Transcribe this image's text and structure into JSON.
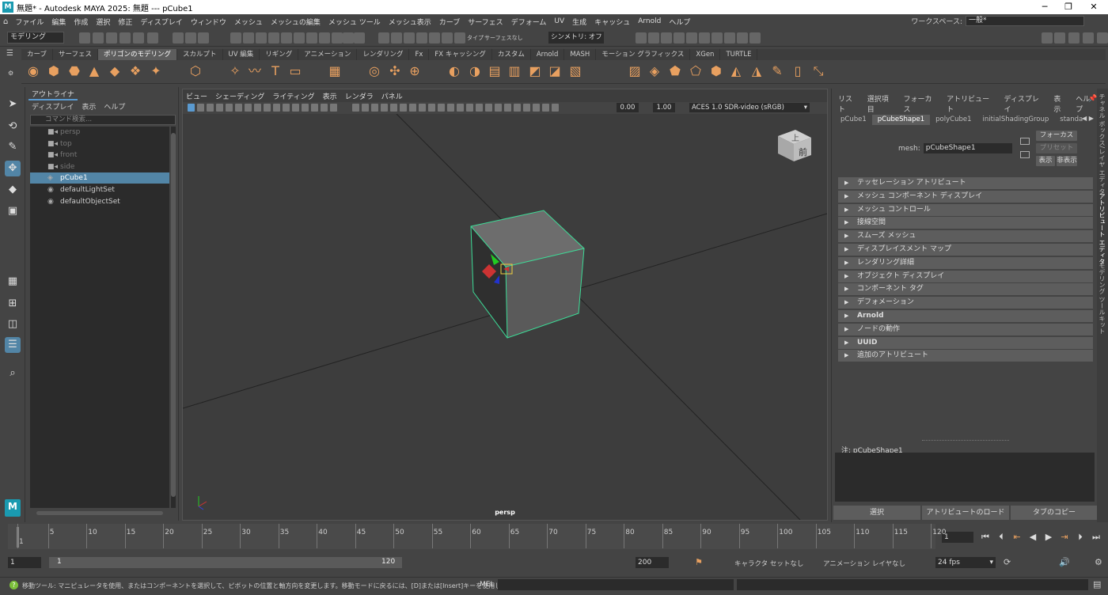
{
  "window": {
    "title": "無題* - Autodesk MAYA 2025: 無題   ---   pCube1",
    "minimize": "─",
    "maximize": "❐",
    "close": "✕"
  },
  "menu": [
    "ファイル",
    "編集",
    "作成",
    "選択",
    "修正",
    "ディスプレイ",
    "ウィンドウ",
    "メッシュ",
    "メッシュの編集",
    "メッシュ ツール",
    "メッシュ表示",
    "カーブ",
    "サーフェス",
    "デフォーム",
    "UV",
    "生成",
    "キャッシュ",
    "Arnold",
    "ヘルプ"
  ],
  "workspace": {
    "label": "ワークスペース:",
    "value": "一般*"
  },
  "statusline": {
    "mode": "モデリング",
    "type_label": "タイプ",
    "surface": "サーフェスなし",
    "symmetry": "シンメトリ: オフ"
  },
  "shelf_tabs": [
    "カーブ",
    "サーフェス",
    "ポリゴンのモデリング",
    "スカルプト",
    "UV 編集",
    "リギング",
    "アニメーション",
    "レンダリング",
    "Fx",
    "FX キャッシング",
    "カスタム",
    "Arnold",
    "MASH",
    "モーション グラフィックス",
    "XGen",
    "TURTLE"
  ],
  "shelf_active": "ポリゴンのモデリング",
  "outliner": {
    "title": "アウトライナ",
    "menu": [
      "ディスプレイ",
      "表示",
      "ヘルプ"
    ],
    "search_placeholder": "コマンド検索...",
    "items": [
      {
        "label": "persp",
        "icon": "camera-icon"
      },
      {
        "label": "top",
        "icon": "camera-icon"
      },
      {
        "label": "front",
        "icon": "camera-icon"
      },
      {
        "label": "side",
        "icon": "camera-icon"
      },
      {
        "label": "pCube1",
        "icon": "mesh-icon"
      },
      {
        "label": "defaultLightSet",
        "icon": "set-icon"
      },
      {
        "label": "defaultObjectSet",
        "icon": "set-icon"
      }
    ]
  },
  "viewport": {
    "menu": [
      "ビュー",
      "シェーディング",
      "ライティング",
      "表示",
      "レンダラ",
      "パネル"
    ],
    "exposure": "0.00",
    "gamma": "1.00",
    "colorspace": "ACES 1.0 SDR-video (sRGB)",
    "camera_label": "persp",
    "viewcube_top": "上",
    "viewcube_front": "前"
  },
  "attribute_editor": {
    "menu": [
      "リスト",
      "選択項目",
      "フォーカス",
      "アトリビュート",
      "ディスプレイ",
      "表示",
      "ヘルプ"
    ],
    "tabs": [
      "pCube1",
      "pCubeShape1",
      "polyCube1",
      "initialShadingGroup",
      "standa"
    ],
    "active_tab": "pCubeShape1",
    "mesh_label": "mesh:",
    "mesh_value": "pCubeShape1",
    "btn_focus": "フォーカス",
    "btn_preset": "プリセット",
    "btn_show": "表示",
    "btn_hide": "非表示",
    "sections": [
      "テッセレーション アトリビュート",
      "メッシュ コンポーネント ディスプレイ",
      "メッシュ コントロール",
      "接線空間",
      "スムーズ メッシュ",
      "ディスプレイスメント マップ",
      "レンダリング詳細",
      "オブジェクト ディスプレイ",
      "コンポーネント タグ",
      "デフォメーション",
      "Arnold",
      "ノードの動作",
      "UUID",
      "追加のアトリビュート"
    ],
    "note_label": "注:  pCubeShape1",
    "buttons": [
      "選択",
      "アトリビュートのロード",
      "タブのコピー"
    ]
  },
  "side_tabs": [
    "チャネル ボックス/レイヤ エディタ",
    "アトリビュート エディタ",
    "モデリング ツールキット"
  ],
  "timeline": {
    "ticks": [
      "1",
      "5",
      "10",
      "15",
      "20",
      "25",
      "30",
      "35",
      "40",
      "45",
      "50",
      "55",
      "60",
      "65",
      "70",
      "75",
      "80",
      "85",
      "90",
      "95",
      "100",
      "105",
      "110",
      "115",
      "120"
    ],
    "current_frame": "1"
  },
  "range": {
    "start": "1",
    "anim_start": "1",
    "anim_end": "120",
    "end": "200",
    "character_set": "キャラクタ セットなし",
    "anim_layer": "アニメーション レイヤなし",
    "fps": "24 fps"
  },
  "helpline": {
    "text": "移動ツール: マニピュレータを使用、またはコンポーネントを選択して、ピボットの位置と軸方向を変更します。移動モードに戻るには、[D]または[Insert]キーを使用します。",
    "mel": "MEL"
  }
}
